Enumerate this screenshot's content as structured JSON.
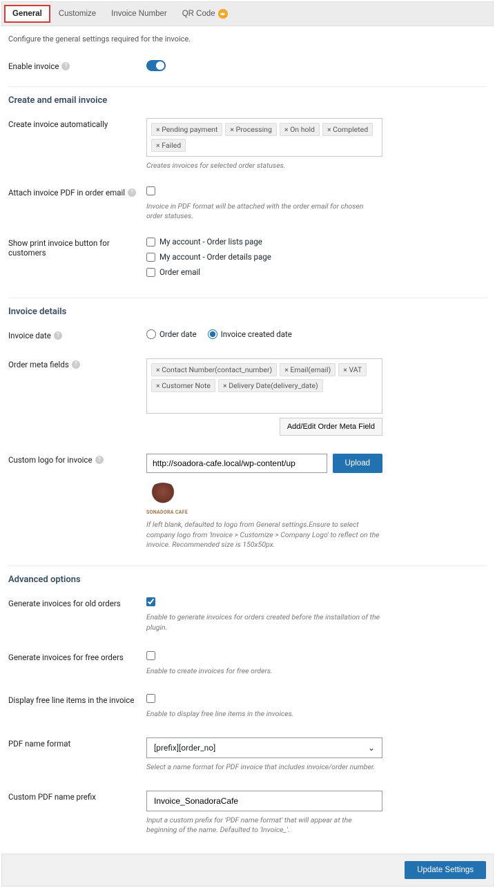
{
  "tabs": {
    "general": "General",
    "customize": "Customize",
    "invoice_number": "Invoice Number",
    "qr_code": "QR Code"
  },
  "description": "Configure the general settings required for the invoice.",
  "enable_invoice": {
    "label": "Enable invoice"
  },
  "sections": {
    "create_email": "Create and email invoice",
    "invoice_details": "Invoice details",
    "advanced": "Advanced options"
  },
  "create_auto": {
    "label": "Create invoice automatically",
    "tags": [
      "× Pending payment",
      "× Processing",
      "× On hold",
      "× Completed",
      "× Failed"
    ],
    "hint": "Creates invoices for selected order statuses."
  },
  "attach_pdf": {
    "label": "Attach invoice PDF in order email",
    "hint": "Invoice in PDF format will be attached with the order email for chosen order statuses."
  },
  "show_print": {
    "label": "Show print invoice button for customers",
    "options": [
      "My account - Order lists page",
      "My account - Order details page",
      "Order email"
    ]
  },
  "invoice_date": {
    "label": "Invoice date",
    "order_date": "Order date",
    "created_date": "Invoice created date"
  },
  "order_meta": {
    "label": "Order meta fields",
    "tags": [
      "× Contact Number(contact_number)",
      "× Email(email)",
      "× VAT",
      "× Customer Note",
      "× Delivery Date(delivery_date)"
    ],
    "button": "Add/Edit Order Meta Field"
  },
  "custom_logo": {
    "label": "Custom logo for invoice",
    "value": "http://soadora-cafe.local/wp-content/up",
    "upload": "Upload",
    "logo_text": "SONADORA CAFE",
    "hint": "If left blank, defaulted to logo from General settings.Ensure to select company logo from 'Invoice > Customize > Company Logo' to reflect on the invoice. Recommended size is 150x50px."
  },
  "gen_old": {
    "label": "Generate invoices for old orders",
    "hint": "Enable to generate invoices for orders created before the installation of the plugin."
  },
  "gen_free": {
    "label": "Generate invoices for free orders",
    "hint": "Enable to create invoices for free orders."
  },
  "display_free": {
    "label": "Display free line items in the invoice",
    "hint": "Enable to display free line items in the invoices."
  },
  "pdf_name": {
    "label": "PDF name format",
    "value": "[prefix][order_no]",
    "hint": "Select a name format for PDF invoice that includes invoice/order number."
  },
  "pdf_prefix": {
    "label": "Custom PDF name prefix",
    "value": "Invoice_SonadoraCafe",
    "hint": "Input a custom prefix for 'PDF name format' that will appear at the beginning of the name. Defaulted to 'Invoice_'."
  },
  "footer": {
    "update": "Update Settings"
  }
}
